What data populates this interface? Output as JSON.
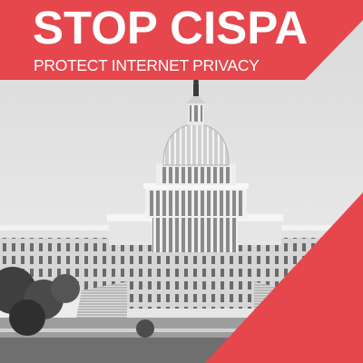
{
  "poster": {
    "headline": "STOP CISPA",
    "subheadline": "PROTECT INTERNET PRIVACY",
    "image_subject": "us-capitol-building",
    "image_style": "black-and-white photograph",
    "colors": {
      "accent": "#e5474d",
      "text": "#ffffff",
      "sky": "#e9e9e9"
    }
  }
}
